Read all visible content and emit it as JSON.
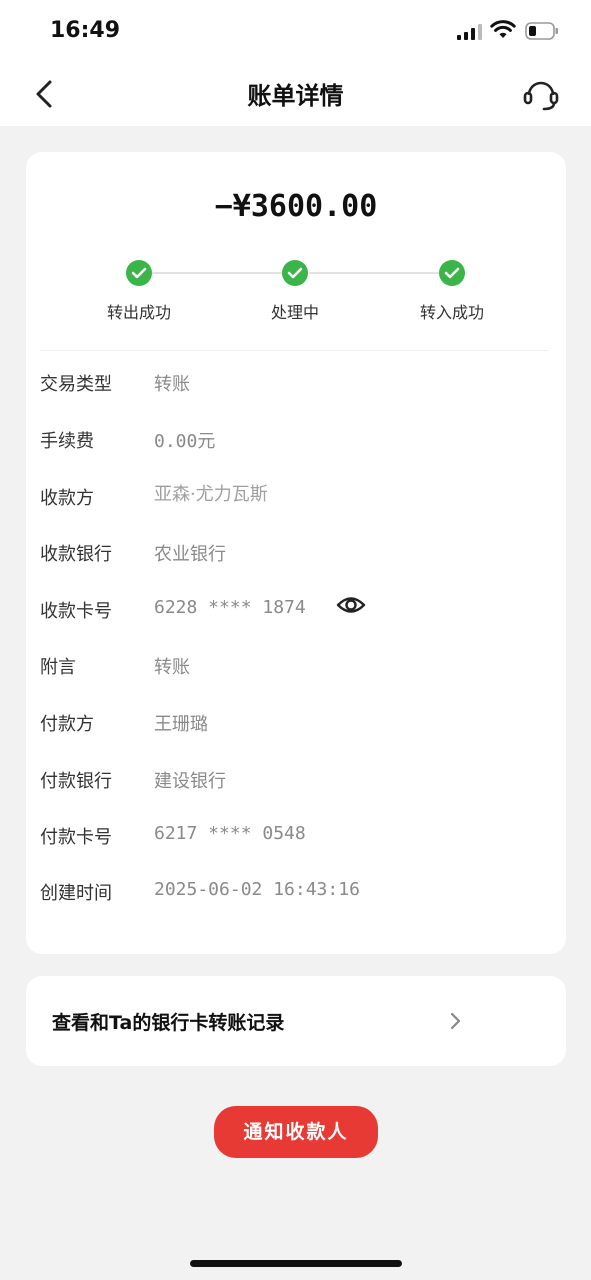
{
  "status_bar": {
    "time": "16:49"
  },
  "nav": {
    "title": "账单详情",
    "back_icon": "chevron-left-icon",
    "service_icon": "headset-icon"
  },
  "summary": {
    "amount": "−¥3600.00",
    "steps": [
      {
        "label": "转出成功",
        "status": "done"
      },
      {
        "label": "处理中",
        "status": "done"
      },
      {
        "label": "转入成功",
        "status": "done"
      }
    ],
    "step_color": "#3bb54a"
  },
  "details": [
    {
      "label": "交易类型",
      "value": "转账"
    },
    {
      "label": "手续费",
      "value": "0.00元"
    },
    {
      "label": "收款方",
      "value": "亚森·尤力瓦斯"
    },
    {
      "label": "收款银行",
      "value": "农业银行"
    },
    {
      "label": "收款卡号",
      "value": "6228 **** 1874"
    },
    {
      "label": "附言",
      "value": "转账"
    },
    {
      "label": "付款方",
      "value": "王珊璐"
    },
    {
      "label": "付款银行",
      "value": "建设银行"
    },
    {
      "label": "付款卡号",
      "value": "6217 **** 0548"
    },
    {
      "label": "创建时间",
      "value": "2025-06-02 16:43:16"
    }
  ],
  "history_link": {
    "label": "查看和Ta的银行卡转账记录"
  },
  "notify_button": {
    "label": "通知收款人",
    "color": "#e83a35"
  }
}
